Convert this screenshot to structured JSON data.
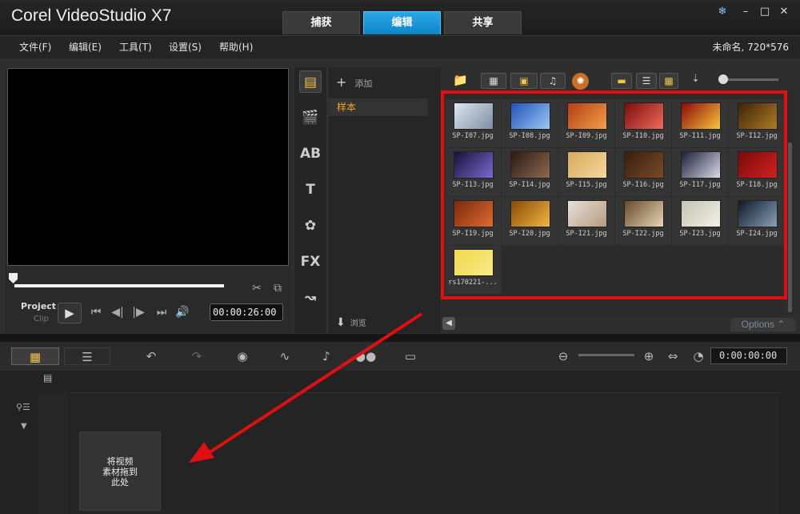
{
  "app": {
    "title": "Corel VideoStudio X7",
    "tabs": [
      {
        "label": "捕获",
        "active": false
      },
      {
        "label": "编辑",
        "active": true
      },
      {
        "label": "共享",
        "active": false
      }
    ],
    "window_controls": [
      "snowflake-icon",
      "minimize-icon",
      "maximize-icon",
      "close-icon"
    ]
  },
  "menu": {
    "items": [
      "文件(F)",
      "编辑(E)",
      "工具(T)",
      "设置(S)",
      "帮助(H)"
    ],
    "project_info": "未命名, 720*576"
  },
  "player": {
    "project_label": "Project",
    "clip_label": "Clip",
    "timecode": "00:00:26:00"
  },
  "library": {
    "add_label": "添加",
    "folders": [
      "样本"
    ],
    "browse_label": "浏览",
    "options_label": "Options",
    "items": [
      {
        "name": "SP-I07.jpg",
        "colors": [
          "#dfe6ee",
          "#7c8fa6"
        ]
      },
      {
        "name": "SP-I08.jpg",
        "colors": [
          "#1f53b9",
          "#9cc7f5"
        ]
      },
      {
        "name": "SP-I09.jpg",
        "colors": [
          "#b23e12",
          "#f2a04a"
        ]
      },
      {
        "name": "SP-I10.jpg",
        "colors": [
          "#7a0d0d",
          "#f06a5a"
        ]
      },
      {
        "name": "SP-I11.jpg",
        "colors": [
          "#8c0a0a",
          "#f7c43a"
        ]
      },
      {
        "name": "SP-I12.jpg",
        "colors": [
          "#3c2408",
          "#b07a26"
        ]
      },
      {
        "name": "SP-I13.jpg",
        "colors": [
          "#16123a",
          "#7b6ad0"
        ]
      },
      {
        "name": "SP-I14.jpg",
        "colors": [
          "#2a1a12",
          "#8e6a52"
        ]
      },
      {
        "name": "SP-I15.jpg",
        "colors": [
          "#d8a95a",
          "#f4d9a0"
        ]
      },
      {
        "name": "SP-I16.jpg",
        "colors": [
          "#3a1e0e",
          "#7a4a26"
        ]
      },
      {
        "name": "SP-I17.jpg",
        "colors": [
          "#1a1f3a",
          "#d9dbe8"
        ]
      },
      {
        "name": "SP-I18.jpg",
        "colors": [
          "#7a0a0a",
          "#d02020"
        ]
      },
      {
        "name": "SP-I19.jpg",
        "colors": [
          "#7a2a10",
          "#e06a30"
        ]
      },
      {
        "name": "SP-I20.jpg",
        "colors": [
          "#8a4a06",
          "#f3b640"
        ]
      },
      {
        "name": "SP-I21.jpg",
        "colors": [
          "#e6e0d8",
          "#b89a80"
        ]
      },
      {
        "name": "SP-I22.jpg",
        "colors": [
          "#6a4a2a",
          "#e6d6b8"
        ]
      },
      {
        "name": "SP-I23.jpg",
        "colors": [
          "#c8c4b4",
          "#f2f0e6"
        ]
      },
      {
        "name": "SP-I24.jpg",
        "colors": [
          "#0c1826",
          "#8aa0b8"
        ]
      },
      {
        "name": "rs170221-...",
        "colors": [
          "#f3d84a",
          "#f8ea8a"
        ]
      }
    ]
  },
  "timeline": {
    "timecode": "0:00:00:00",
    "drop_hint": "将视频\n素材拖到\n此处"
  },
  "colors": {
    "accent": "#1a9ad8",
    "highlight": "#e01010",
    "folder_text": "#f5a623"
  }
}
